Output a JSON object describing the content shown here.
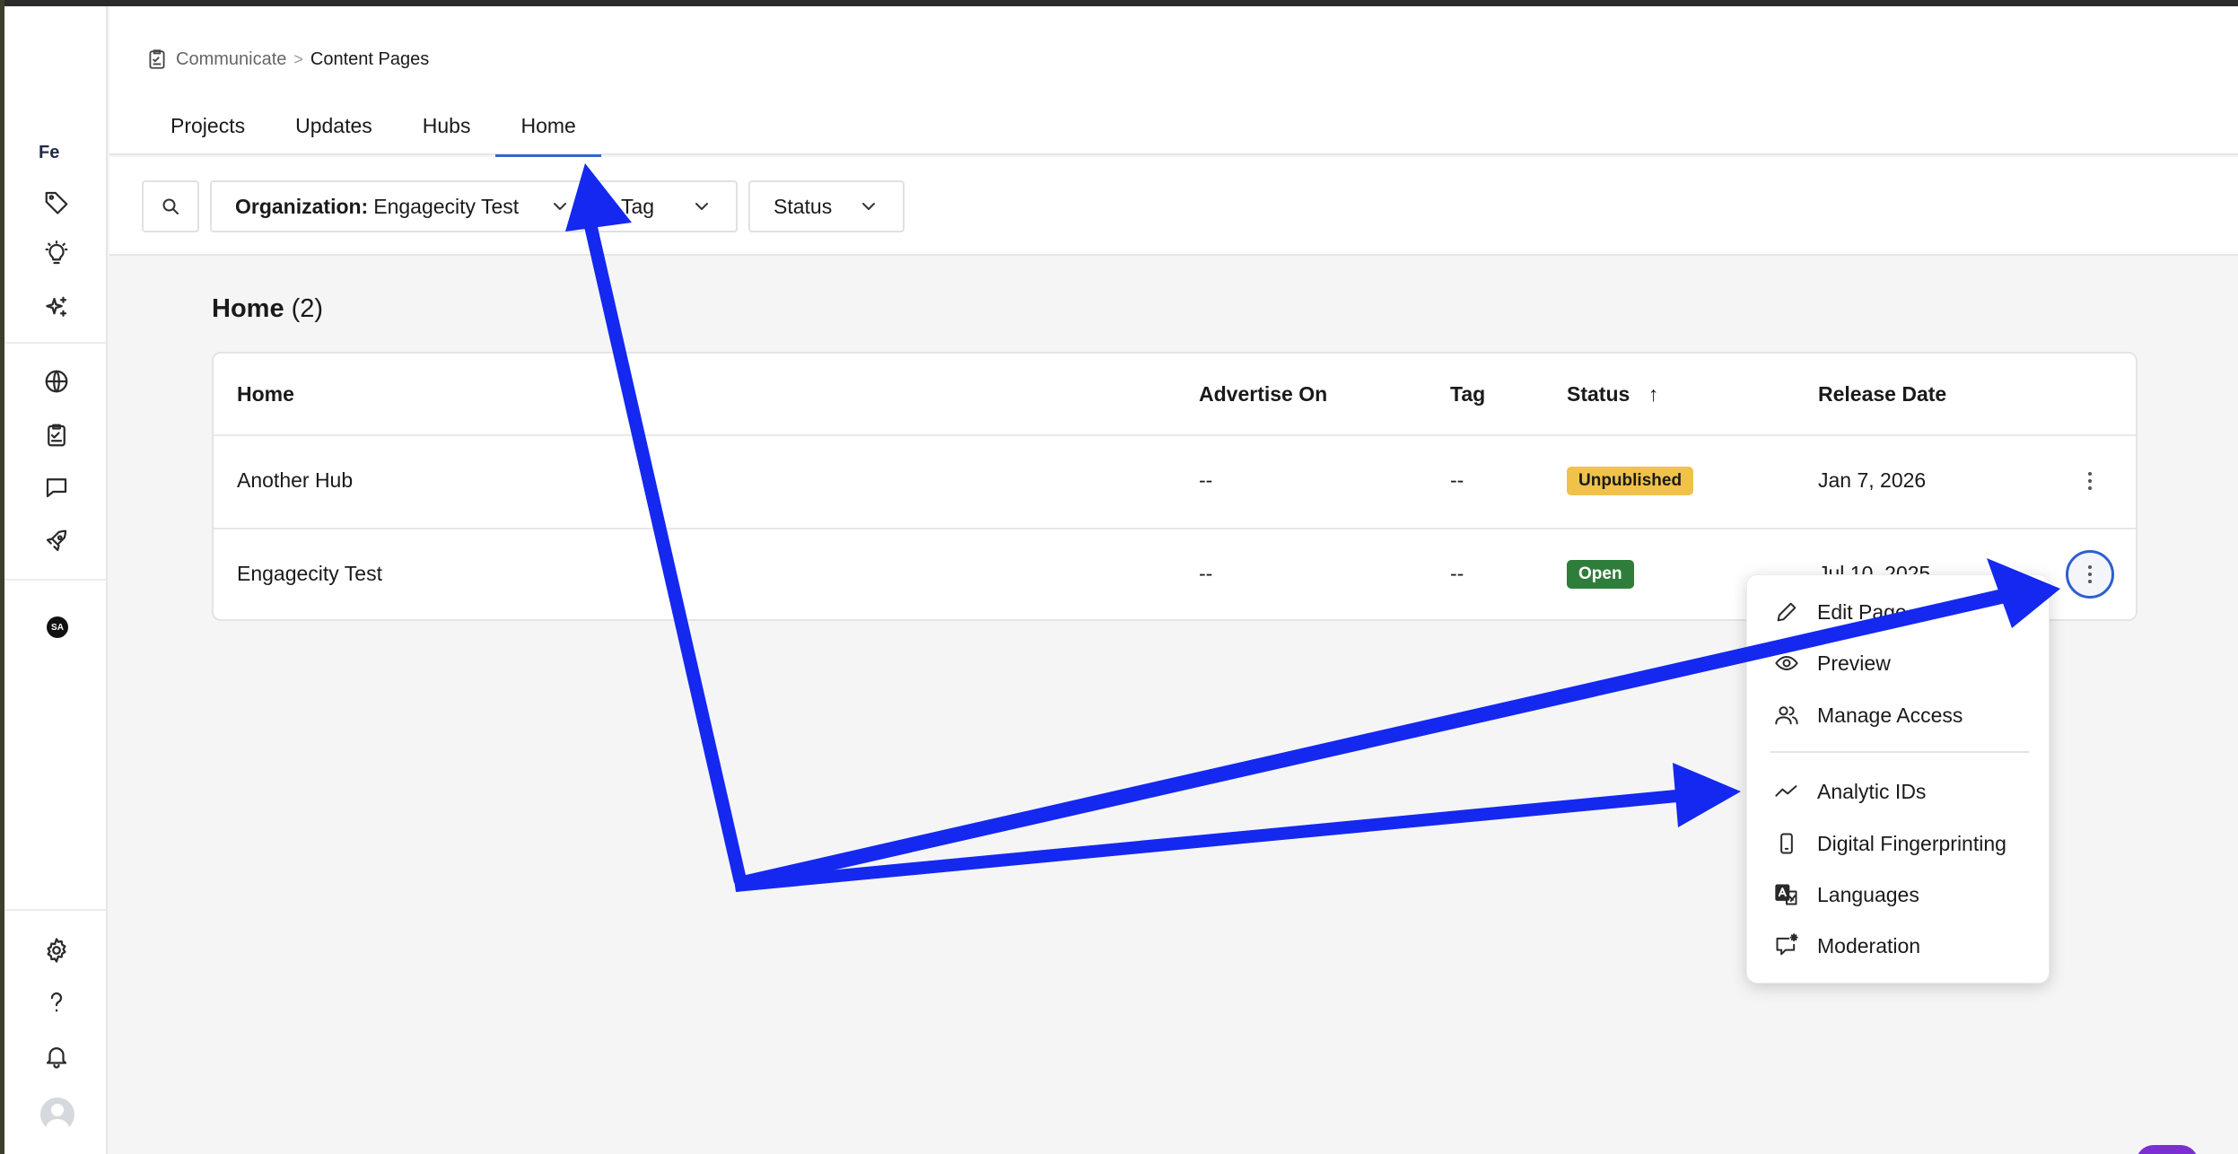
{
  "sidebar": {
    "brand": "Fe",
    "avatar_badge": "SA",
    "icons": [
      "tag-icon",
      "lightbulb-icon",
      "sparkle-icon",
      "globe-icon",
      "clipboard-icon",
      "chat-icon",
      "rocket-icon",
      "gear-icon",
      "help-icon",
      "bell-icon",
      "user-avatar-icon"
    ]
  },
  "breadcrumb": {
    "parent": "Communicate",
    "separator": ">",
    "current": "Content Pages"
  },
  "tabs": [
    {
      "label": "Projects",
      "active": false
    },
    {
      "label": "Updates",
      "active": false
    },
    {
      "label": "Hubs",
      "active": false
    },
    {
      "label": "Home",
      "active": true
    }
  ],
  "filters": {
    "organization_label": "Organization:",
    "organization_value": "Engagecity Test",
    "tag_label": "Tag",
    "status_label": "Status"
  },
  "section": {
    "title": "Home",
    "count": "(2)"
  },
  "table": {
    "columns": [
      "Home",
      "Advertise On",
      "Tag",
      "Status",
      "Release Date"
    ],
    "sort_indicator": "↑",
    "rows": [
      {
        "home": "Another Hub",
        "advertise_on": "--",
        "tag": "--",
        "status": "Unpublished",
        "release_date": "Jan 7, 2026"
      },
      {
        "home": "Engagecity Test",
        "advertise_on": "--",
        "tag": "--",
        "status": "Open",
        "release_date": "Jul 10, 2025"
      }
    ]
  },
  "menu": {
    "items": [
      {
        "label": "Edit Page",
        "icon": "pencil-icon"
      },
      {
        "label": "Preview",
        "icon": "eye-icon"
      },
      {
        "label": "Manage Access",
        "icon": "users-icon"
      },
      {
        "label": "Analytic IDs",
        "icon": "trend-icon"
      },
      {
        "label": "Digital Fingerprinting",
        "icon": "phone-icon"
      },
      {
        "label": "Languages",
        "icon": "translate-icon"
      },
      {
        "label": "Moderation",
        "icon": "moderation-icon"
      }
    ]
  },
  "colors": {
    "accent": "#3a63d6",
    "unpublished_badge": "#f0c24a",
    "open_badge": "#2f7d3a",
    "annotation_arrow": "#1428f0"
  }
}
